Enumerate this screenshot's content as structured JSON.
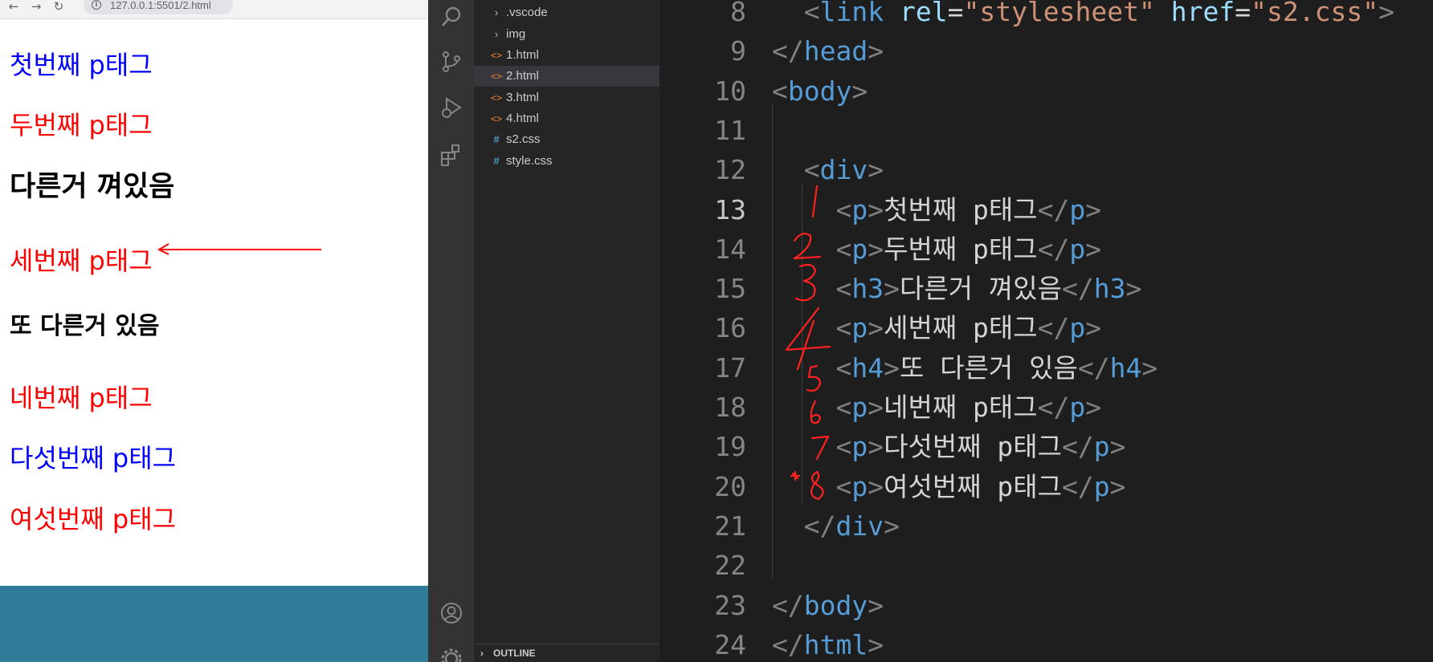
{
  "browser": {
    "url": "127.0.0.1:5501/2.html",
    "nav_icons": [
      "back-arrow-icon",
      "forward-arrow-icon",
      "reload-icon",
      "info-icon"
    ],
    "page": {
      "items": [
        {
          "tag": "p",
          "text": "첫번째 p태그",
          "color": "#0000ff"
        },
        {
          "tag": "p",
          "text": "두번째 p태그",
          "color": "#ff0000"
        },
        {
          "tag": "h3",
          "text": "다른거 껴있음",
          "color": "#000000"
        },
        {
          "tag": "p",
          "text": "세번째 p태그",
          "color": "#ff0000"
        },
        {
          "tag": "h4",
          "text": "또 다른거 있음",
          "color": "#000000"
        },
        {
          "tag": "p",
          "text": "네번째 p태그",
          "color": "#ff0000"
        },
        {
          "tag": "p",
          "text": "다섯번째 p태그",
          "color": "#0000ff"
        },
        {
          "tag": "p",
          "text": "여섯번째 p태그",
          "color": "#ff0000"
        }
      ]
    }
  },
  "activity_bar": {
    "icons": [
      "search-icon",
      "source-control-icon",
      "run-debug-icon",
      "extensions-icon",
      "account-icon",
      "settings-gear-icon"
    ]
  },
  "explorer": {
    "items": [
      {
        "label": ".vscode",
        "kind": "folder"
      },
      {
        "label": "img",
        "kind": "folder"
      },
      {
        "label": "1.html",
        "kind": "html"
      },
      {
        "label": "2.html",
        "kind": "html",
        "active": true
      },
      {
        "label": "3.html",
        "kind": "html"
      },
      {
        "label": "4.html",
        "kind": "html"
      },
      {
        "label": "s2.css",
        "kind": "css"
      },
      {
        "label": "style.css",
        "kind": "css"
      }
    ],
    "outline_label": "OUTLINE"
  },
  "editor": {
    "current_line": 13,
    "lines": [
      {
        "n": "8",
        "code": "  <link rel=\"stylesheet\" href=\"s2.css\">"
      },
      {
        "n": "9",
        "code": "</head>"
      },
      {
        "n": "10",
        "code": "<body>"
      },
      {
        "n": "11",
        "code": ""
      },
      {
        "n": "12",
        "code": "  <div>"
      },
      {
        "n": "13",
        "code": "    <p>첫번째 p태그</p>"
      },
      {
        "n": "14",
        "code": "    <p>두번째 p태그</p>"
      },
      {
        "n": "15",
        "code": "    <h3>다른거 껴있음</h3>"
      },
      {
        "n": "16",
        "code": "    <p>세번째 p태그</p>"
      },
      {
        "n": "17",
        "code": "    <h4>또 다른거 있음</h4>"
      },
      {
        "n": "18",
        "code": "    <p>네번째 p태그</p>"
      },
      {
        "n": "19",
        "code": "    <p>다섯번째 p태그</p>"
      },
      {
        "n": "20",
        "code": "    <p>여섯번째 p태그</p>"
      },
      {
        "n": "21",
        "code": "  </div>"
      },
      {
        "n": "22",
        "code": ""
      },
      {
        "n": "23",
        "code": "</body>"
      },
      {
        "n": "24",
        "code": "</html>"
      }
    ],
    "annotations": [
      "1",
      "2",
      "3",
      "4",
      "5",
      "6",
      "7",
      "*8"
    ],
    "annotation_color": "#ff2020"
  },
  "colors": {
    "browser_footer": "#2f7c9a",
    "selection": "#264f78",
    "tag": "#569cd6",
    "attr": "#9cdcfe",
    "string": "#ce9178"
  }
}
